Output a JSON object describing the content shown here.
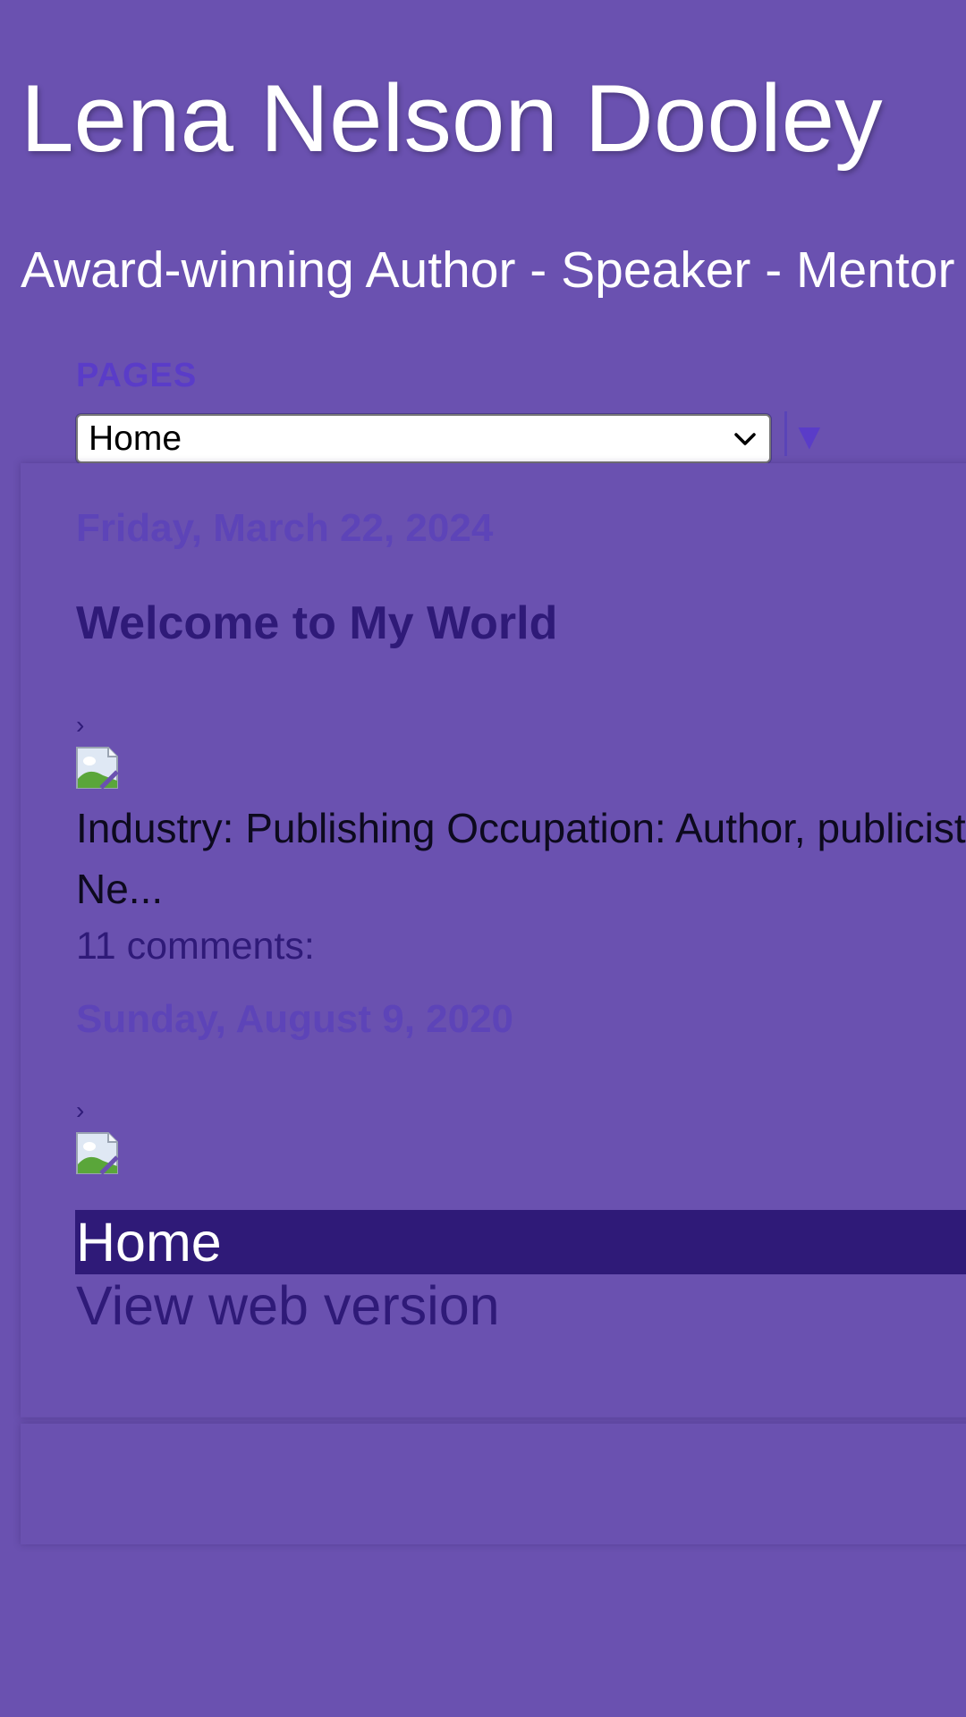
{
  "blog": {
    "title": "Lena Nelson Dooley",
    "description": "Award-winning Author - Speaker - Mentor"
  },
  "pages_widget": {
    "label": "PAGES",
    "selected": "Home",
    "arrow": "▼"
  },
  "posts": [
    {
      "date": "Friday, March 22, 2024",
      "title": "Welcome to My World",
      "chevron": "›",
      "snippet_line1": "Industry: Publishing Occupation: Author, publicist",
      "snippet_line2": "Ne...",
      "comments": "11 comments:"
    },
    {
      "date": "Sunday, August 9, 2020",
      "chevron": "›"
    }
  ],
  "mobile_footer": {
    "home": "Home",
    "web_version": "View web version"
  },
  "colors": {
    "background": "#6a51b0",
    "link_dark": "#2f1a78",
    "date_color": "#5d44b8",
    "title_white": "#ffffff"
  },
  "icons": {
    "broken_image": "broken-image-icon",
    "dropdown": "chevron-down-icon"
  }
}
